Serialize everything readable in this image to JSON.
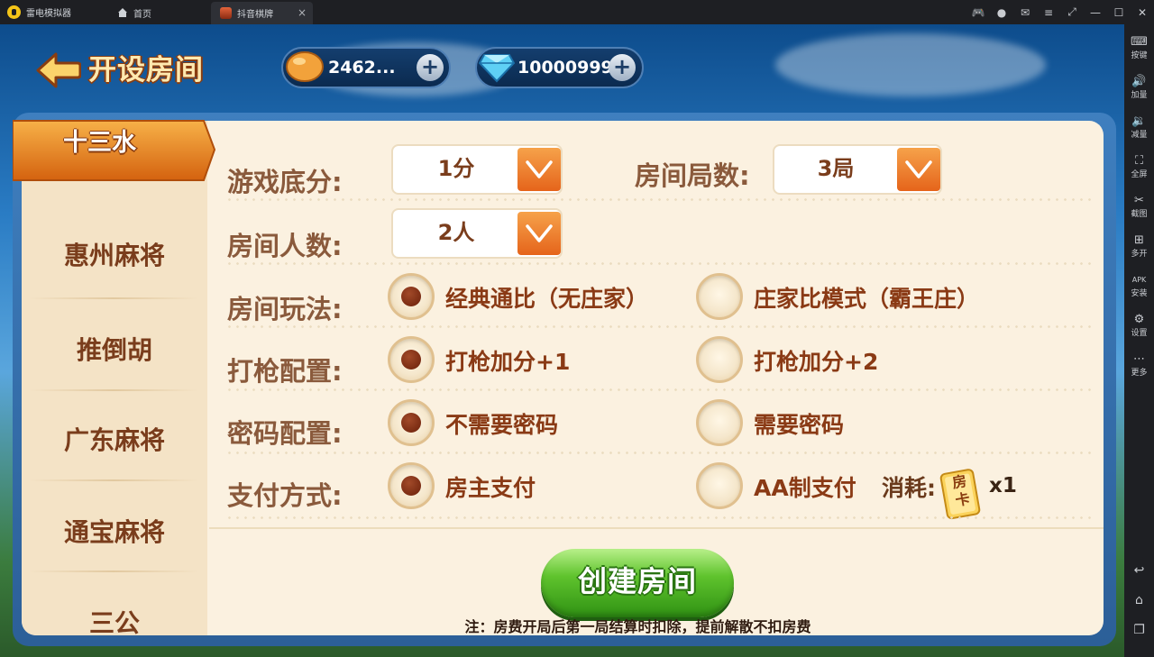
{
  "emulator": {
    "app_name": "雷电模拟器",
    "tabs": [
      {
        "label": "首页"
      },
      {
        "label": "抖音棋牌"
      }
    ],
    "tab_close": "×",
    "controls": [
      {
        "name": "gamepad-icon",
        "glyph": "🎮"
      },
      {
        "name": "account-icon",
        "glyph": "●"
      },
      {
        "name": "mail-icon",
        "glyph": "✉"
      },
      {
        "name": "menu-icon",
        "glyph": "≡"
      },
      {
        "name": "restore-icon",
        "glyph": "⤢"
      },
      {
        "name": "minimize-icon",
        "glyph": "—"
      },
      {
        "name": "maximize-icon",
        "glyph": "☐"
      },
      {
        "name": "close-icon",
        "glyph": "✕"
      }
    ],
    "sidebar": [
      {
        "label": "按键",
        "glyph": "⌨"
      },
      {
        "label": "加量",
        "glyph": "🔊"
      },
      {
        "label": "减量",
        "glyph": "🔉"
      },
      {
        "label": "全屏",
        "glyph": "⛶"
      },
      {
        "label": "截图",
        "glyph": "✂"
      },
      {
        "label": "多开",
        "glyph": "⊞"
      },
      {
        "label": "安装",
        "glyph": "APK"
      },
      {
        "label": "设置",
        "glyph": "⚙"
      },
      {
        "label": "更多",
        "glyph": "⋯"
      }
    ],
    "nav": [
      {
        "name": "back-nav-icon",
        "glyph": "↩"
      },
      {
        "name": "home-nav-icon",
        "glyph": "⌂"
      },
      {
        "name": "recents-nav-icon",
        "glyph": "❐"
      }
    ]
  },
  "header": {
    "title": "开设房间",
    "beans_value": "2462...",
    "diamonds_value": "10000999",
    "plus": "+"
  },
  "categories": [
    {
      "label": "十三水",
      "active": true
    },
    {
      "label": "惠州麻将"
    },
    {
      "label": "推倒胡"
    },
    {
      "label": "广东麻将"
    },
    {
      "label": "通宝麻将"
    },
    {
      "label": "三公"
    }
  ],
  "settings": {
    "base_score": {
      "label": "游戏底分:",
      "value": "1分"
    },
    "rounds": {
      "label": "房间局数:",
      "value": "3局"
    },
    "players": {
      "label": "房间人数:",
      "value": "2人"
    },
    "mode": {
      "label": "房间玩法:",
      "options": [
        "经典通比（无庄家）",
        "庄家比模式（霸王庄）"
      ],
      "selected": 0
    },
    "gun": {
      "label": "打枪配置:",
      "options": [
        "打枪加分+1",
        "打枪加分+2"
      ],
      "selected": 0
    },
    "password": {
      "label": "密码配置:",
      "options": [
        "不需要密码",
        "需要密码"
      ],
      "selected": 0
    },
    "payment": {
      "label": "支付方式:",
      "options": [
        "房主支付",
        "AA制支付"
      ],
      "selected": 0
    },
    "cost_label": "消耗:",
    "cost_card": "房卡",
    "cost_mult": "x1"
  },
  "create_button": "创建房间",
  "note": "注：房费开局后第一局结算时扣除，提前解散不扣房费",
  "colors": {
    "accent_orange": "#e5641b",
    "create_green": "#4db420",
    "panel_bg": "#fbf1e0",
    "label_brown": "#8a5a3c"
  }
}
